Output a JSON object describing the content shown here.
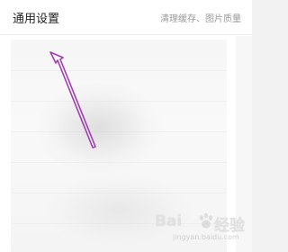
{
  "header": {
    "title": "通用设置",
    "subtitle": "清理缓存、图片质量"
  },
  "watermark": {
    "brand_left": "Bai",
    "brand_right": "经验",
    "url": "jingyan.baidu.com"
  },
  "colors": {
    "arrow": "#a040b0",
    "title_text": "#222222",
    "subtitle_text": "#999999"
  }
}
